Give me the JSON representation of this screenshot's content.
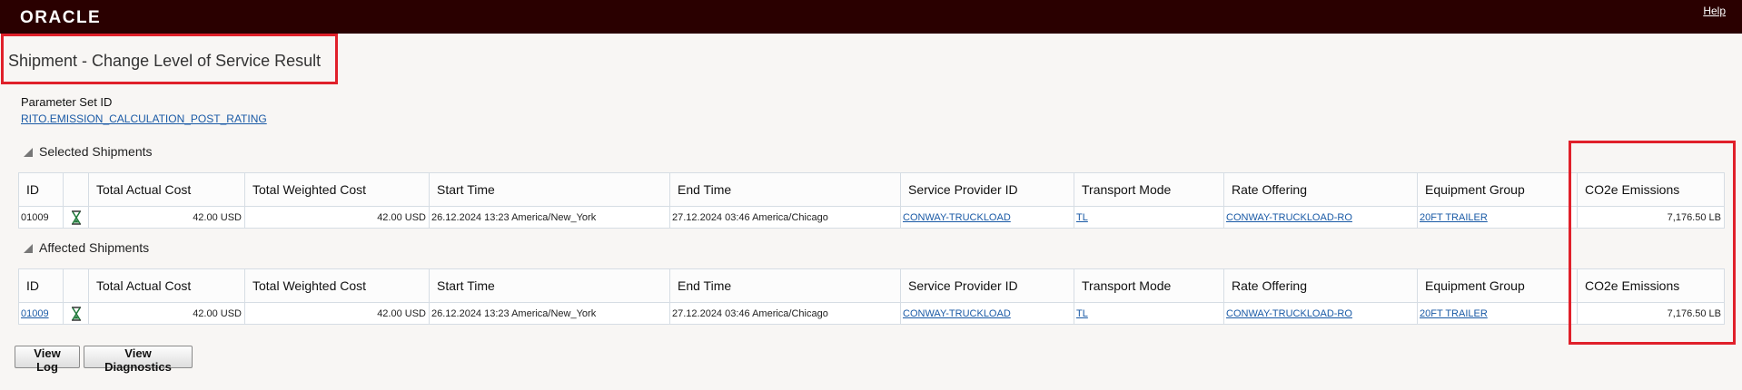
{
  "header": {
    "logo_text": "ORACLE",
    "help_label": "Help"
  },
  "page": {
    "title": "Shipment - Change Level of Service Result",
    "parameter_set_label": "Parameter Set ID",
    "parameter_set_value": "RITO.EMISSION_CALCULATION_POST_RATING"
  },
  "columns": [
    "ID",
    "",
    "Total Actual Cost",
    "Total Weighted Cost",
    "Start Time",
    "End Time",
    "Service Provider ID",
    "Transport Mode",
    "Rate Offering",
    "Equipment Group",
    "CO2e Emissions"
  ],
  "selected": {
    "title": "Selected Shipments",
    "row": {
      "id": "01009",
      "total_actual_cost": "42.00 USD",
      "total_weighted_cost": "42.00 USD",
      "start_time": "26.12.2024 13:23 America/New_York",
      "end_time": "27.12.2024 03:46 America/Chicago",
      "service_provider": "CONWAY-TRUCKLOAD",
      "transport_mode": "TL",
      "rate_offering": "CONWAY-TRUCKLOAD-RO",
      "equipment_group": "20FT TRAILER",
      "co2e": "7,176.50 LB"
    }
  },
  "affected": {
    "title": "Affected Shipments",
    "row": {
      "id": "01009",
      "total_actual_cost": "42.00 USD",
      "total_weighted_cost": "42.00 USD",
      "start_time": "26.12.2024 13:23 America/New_York",
      "end_time": "27.12.2024 03:46 America/Chicago",
      "service_provider": "CONWAY-TRUCKLOAD",
      "transport_mode": "TL",
      "rate_offering": "CONWAY-TRUCKLOAD-RO",
      "equipment_group": "20FT TRAILER",
      "co2e": "7,176.50 LB"
    }
  },
  "buttons": {
    "view_log": "View Log",
    "view_diagnostics": "View Diagnostics"
  },
  "icons": {
    "status": "hourglass-icon",
    "collapse": "triangle-collapse-icon"
  },
  "colors": {
    "header_bg": "#2a0000",
    "highlight": "#e0202a",
    "link": "#1a5aa6"
  }
}
